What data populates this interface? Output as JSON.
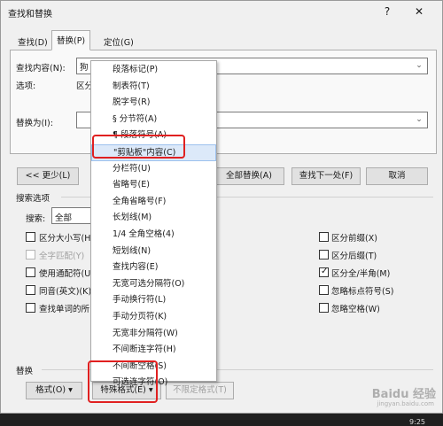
{
  "window": {
    "title": "查找和替换",
    "help_glyph": "?",
    "close_glyph": "✕"
  },
  "tabs": [
    {
      "label": "查找(D)"
    },
    {
      "label": "替换(P)"
    },
    {
      "label": "定位(G)"
    }
  ],
  "find": {
    "label": "查找内容(N):",
    "value": "狗",
    "options_label": "选项:",
    "options_value": "区分"
  },
  "replace": {
    "label": "替换为(I):",
    "value": ""
  },
  "buttons": {
    "less": "<< 更少(L)",
    "replace_all": "全部替换(A)",
    "find_next": "查找下一处(F)",
    "cancel": "取消"
  },
  "search_options": {
    "section_label": "搜索选项",
    "search_label": "搜索:",
    "search_value": "全部",
    "left": [
      {
        "label": "区分大小写(H)",
        "checked": false,
        "disabled": false
      },
      {
        "label": "全字匹配(Y)",
        "checked": false,
        "disabled": true
      },
      {
        "label": "使用通配符(U)",
        "checked": false,
        "disabled": false
      },
      {
        "label": "同音(英文)(K)",
        "checked": false,
        "disabled": false
      },
      {
        "label": "查找单词的所",
        "checked": false,
        "disabled": false
      }
    ],
    "right": [
      {
        "label": "区分前缀(X)",
        "checked": false
      },
      {
        "label": "区分后缀(T)",
        "checked": false
      },
      {
        "label": "区分全/半角(M)",
        "checked": true
      },
      {
        "label": "忽略标点符号(S)",
        "checked": false
      },
      {
        "label": "忽略空格(W)",
        "checked": false
      }
    ]
  },
  "replace_section": {
    "label": "替换",
    "format_button": "格式(O) ▾",
    "special_button": "特殊格式(E) ▾",
    "no_format_button": "不限定格式(T)"
  },
  "special_menu": {
    "items": [
      "段落标记(P)",
      "制表符(T)",
      "脱字号(R)",
      "§ 分节符(A)",
      "¶ 段落符号(A)",
      "\"剪贴板\"内容(C)",
      "分栏符(U)",
      "省略号(E)",
      "全角省略号(F)",
      "长划线(M)",
      "1/4 全角空格(4)",
      "短划线(N)",
      "查找内容(E)",
      "无宽可选分隔符(O)",
      "手动换行符(L)",
      "手动分页符(K)",
      "无宽非分隔符(W)",
      "不间断连字符(H)",
      "不间断空格(S)",
      "可选连字符(O)"
    ],
    "highlighted_index": 5
  },
  "watermark": {
    "text": "Baidu 经验",
    "sub": "jingyan.baidu.com"
  },
  "taskbar": {
    "clock": "9:25"
  },
  "colors": {
    "highlight_box": "#e02020",
    "menu_hover": "#dce9f9"
  }
}
